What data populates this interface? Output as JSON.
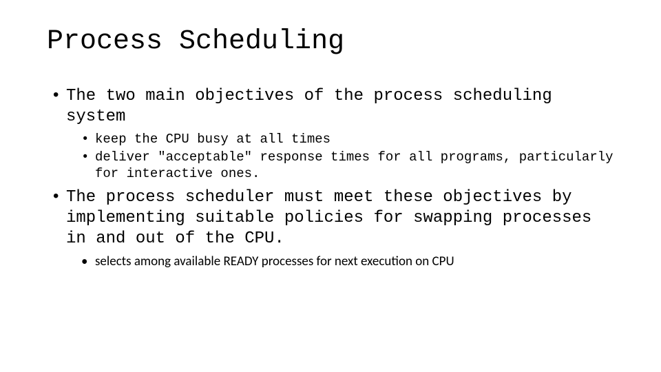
{
  "title": "Process Scheduling",
  "bullets": {
    "b1": "The two main objectives of the process scheduling system",
    "b1_sub1": "keep the CPU busy at all times",
    "b1_sub2": "deliver \"acceptable\" response times for all programs, particularly for interactive ones.",
    "b2": "The process scheduler must meet these objectives by implementing suitable policies for swapping processes in and out of the CPU.",
    "b2_sub1": "selects among available READY processes for next execution on CPU"
  }
}
